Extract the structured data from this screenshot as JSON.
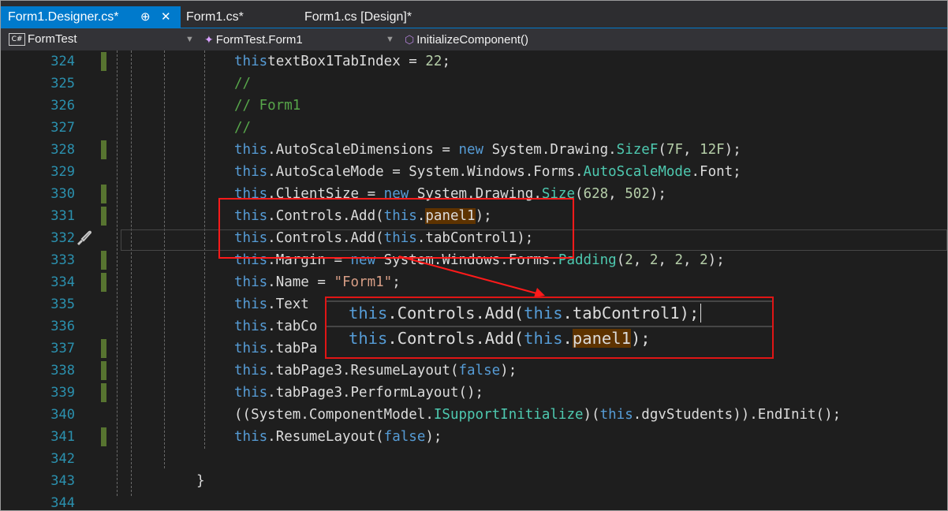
{
  "tabs": [
    {
      "label": "Form1.Designer.cs*",
      "active": true,
      "pin": "⊕",
      "close": "✕"
    },
    {
      "label": "Form1.cs*",
      "active": false
    },
    {
      "label": "Form1.cs [Design]*",
      "active": false
    }
  ],
  "navbar": {
    "project": {
      "badge": "C#",
      "label": "FormTest"
    },
    "class": {
      "label": "FormTest.Form1"
    },
    "member": {
      "label": "InitializeComponent()"
    }
  },
  "editor": {
    "line_numbers": [
      "324",
      "325",
      "326",
      "327",
      "328",
      "329",
      "330",
      "331",
      "332",
      "333",
      "334",
      "335",
      "336",
      "337",
      "338",
      "339",
      "340",
      "341",
      "342",
      "343",
      "344"
    ],
    "lines": [
      {
        "this": "this",
        ".": ".",
        "a": "textBox1",
        ".2": ".",
        "b": "TabIndex = ",
        "n": "22",
        ";": ";"
      },
      {
        "comment": "//"
      },
      {
        "comment": "// Form1"
      },
      {
        "comment": "//"
      }
    ],
    "code": {
      "l328": {
        "p1": ".AutoScaleDimensions = ",
        "kw": "new",
        "p2": " System.Drawing.",
        "ty": "SizeF",
        "p3": "(",
        "n1": "7F",
        "p4": ", ",
        "n2": "12F",
        "p5": ");"
      },
      "l329": {
        "p1": ".AutoScaleMode = System.Windows.Forms.",
        "ty": "AutoScaleMode",
        "p2": ".Font;"
      },
      "l330": {
        "p1": ".ClientSize = ",
        "kw": "new",
        "p2": " System.Drawing.",
        "ty": "Size",
        "p3": "(",
        "n1": "628",
        "p4": ", ",
        "n2": "502",
        "p5": ");"
      },
      "l331": {
        "p1": ".Controls.Add(",
        "p2": ".",
        "hl": "panel1",
        "p3": ");"
      },
      "l332": {
        "p1": ".Controls.Add(",
        "p2": ".tabControl1);"
      },
      "l333": {
        "p1": ".Margin = ",
        "kw": "new",
        "p2": " System.Windows.Forms.",
        "ty": "Padding",
        "p3": "(",
        "n1": "2",
        "c1": ", ",
        "n2": "2",
        "c2": ", ",
        "n3": "2",
        "c3": ", ",
        "n4": "2",
        "p4": ");"
      },
      "l334": {
        "p1": ".Name = ",
        "st": "\"Form1\"",
        "p2": ";"
      },
      "l335": {
        "p1": ".Text"
      },
      "l336": {
        "p1": ".tabCo"
      },
      "l337": {
        "p1": ".tabPa"
      },
      "l338": {
        "p1": ".tabPage3.ResumeLayout(",
        "kw": "false",
        "p2": ");"
      },
      "l339": {
        "p1": ".tabPage3.PerformLayout();"
      },
      "l340": {
        "p0": "((System.ComponentModel.",
        "ty": "ISupportInitialize",
        "p1": ")(",
        "p2": ".dgvStudents)).EndInit();"
      },
      "l341": {
        "p1": ".ResumeLayout(",
        "kw": "false",
        "p2": ");"
      },
      "l343": {
        "p1": "}"
      }
    },
    "this_kw": "this",
    "popup": {
      "line1": {
        "p1": ".Controls.Add(",
        "p2": ".tabControl1);"
      },
      "line2": {
        "p1": ".Controls.Add(",
        "p2": ".",
        "hl": "panel1",
        "p3": ");"
      }
    }
  },
  "colors": {
    "keyword": "#569cd6",
    "type": "#4ec9b0",
    "number": "#b5cea8",
    "string": "#d69d85",
    "comment": "#57a64a",
    "highlight": "#5e3300",
    "line_number": "#2b91af",
    "change_bar": "#577430",
    "annotation": "#ff1a1a",
    "accent": "#007acc"
  },
  "icons": [
    "pin-icon",
    "close-icon",
    "csharp-file-icon",
    "class-icon",
    "method-icon",
    "dropdown-arrow-icon",
    "quick-actions-brush-icon"
  ]
}
